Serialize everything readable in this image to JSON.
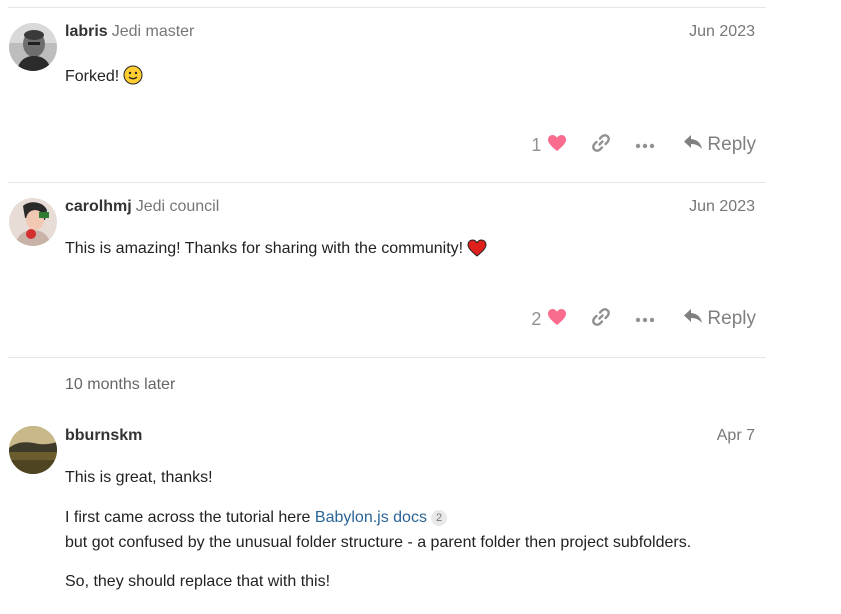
{
  "posts": [
    {
      "username": "labris",
      "user_title": "Jedi master",
      "date": "Jun 2023",
      "body": "Forked!",
      "emoji": "slightly-smiling-face",
      "likes": "1",
      "reply_label": "Reply"
    },
    {
      "username": "carolhmj",
      "user_title": "Jedi council",
      "date": "Jun 2023",
      "body": "This is amazing! Thanks for sharing with the community!",
      "emoji": "red-heart",
      "likes": "2",
      "reply_label": "Reply"
    },
    {
      "username": "bburnskm",
      "user_title": "",
      "date": "Apr 7",
      "paragraphs": [
        "This is great, thanks!",
        "I first came across the tutorial here",
        "but got confused by the unusual folder structure - a parent folder then project subfolders.",
        "So, they should replace that with this!"
      ],
      "link_text": "Babylon.js docs",
      "link_click_count": "2"
    }
  ],
  "time_gap": "10 months later",
  "colors": {
    "like_heart": "#fa6c8d",
    "link": "#2a6496",
    "muted": "#919191"
  },
  "icons": [
    "heart-icon",
    "link-icon",
    "more-icon",
    "reply-icon"
  ]
}
